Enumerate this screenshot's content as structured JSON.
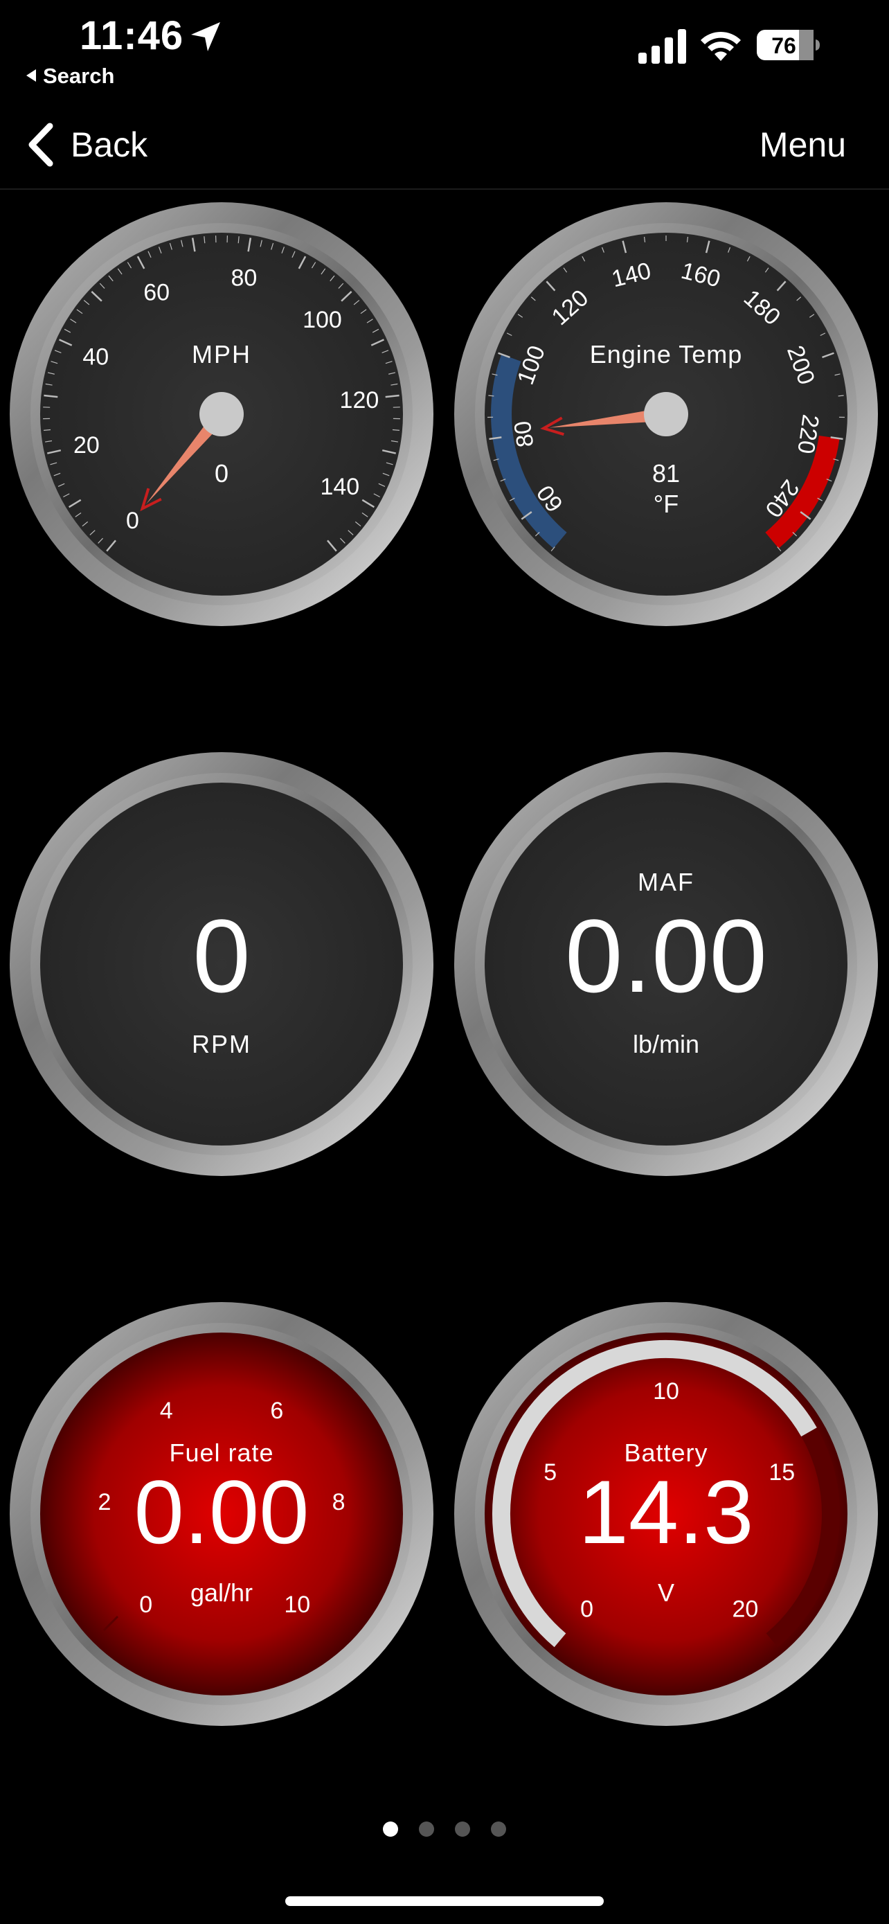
{
  "status_bar": {
    "time": "11:46",
    "back_app": "Search",
    "battery_level": "76",
    "location_icon": "location-arrow-icon",
    "signal_icon": "cellular-signal-icon",
    "wifi_icon": "wifi-icon"
  },
  "nav": {
    "back_label": "Back",
    "menu_label": "Menu"
  },
  "gauges": {
    "speed": {
      "label": "MPH",
      "value": "0",
      "ticks": [
        "0",
        "20",
        "40",
        "60",
        "80",
        "100",
        "120",
        "140"
      ],
      "min": 0,
      "max": 150
    },
    "engine_temp": {
      "label": "Engine Temp",
      "value": "81",
      "unit": "°F",
      "ticks": [
        "60",
        "80",
        "100",
        "120",
        "140",
        "160",
        "180",
        "200",
        "220",
        "240"
      ],
      "min": 50,
      "max": 250,
      "cold_zone_end": 100,
      "hot_zone_start": 220
    },
    "rpm": {
      "value": "0",
      "label": "RPM"
    },
    "maf": {
      "label": "MAF",
      "value": "0.00",
      "unit": "lb/min"
    },
    "fuel_rate": {
      "label": "Fuel rate",
      "value": "0.00",
      "unit": "gal/hr",
      "ticks": [
        "0",
        "2",
        "4",
        "6",
        "8",
        "10"
      ],
      "min": 0,
      "max": 10
    },
    "battery": {
      "label": "Battery",
      "value": "14.3",
      "unit": "V",
      "ticks": [
        "0",
        "5",
        "10",
        "15",
        "20"
      ],
      "min": 0,
      "max": 20
    }
  },
  "pagination": {
    "total": 4,
    "current": 1
  },
  "colors": {
    "background": "#000000",
    "needle": "#e8856b",
    "cold_zone": "#2c4f7c",
    "hot_zone": "#cc0000",
    "red_face": "#cc0000",
    "dark_face": "#2a2a2a"
  }
}
